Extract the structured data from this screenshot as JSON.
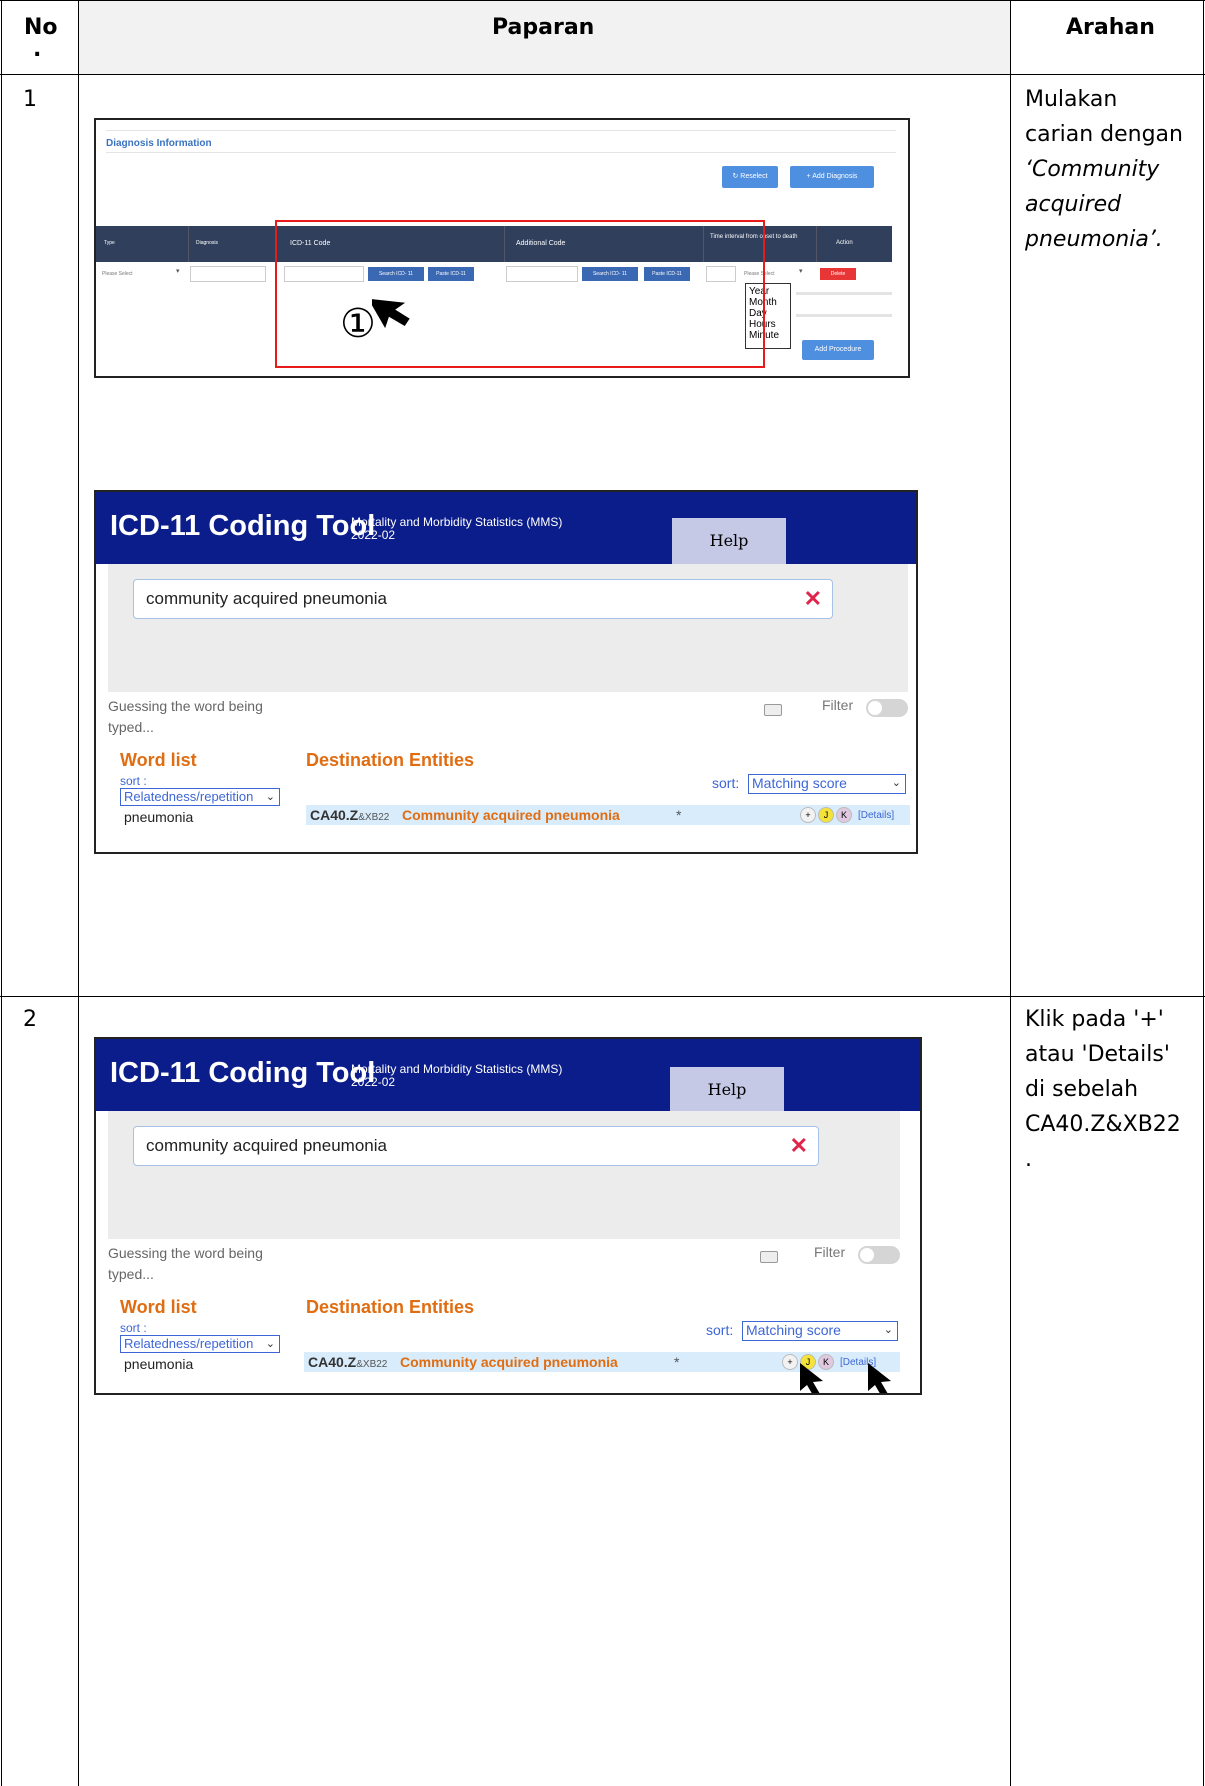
{
  "table": {
    "headers": {
      "no": "No",
      "no_dot": ".",
      "paparan": "Paparan",
      "arahan": "Arahan"
    },
    "rows": [
      {
        "no": "1",
        "arahan_lines": [
          "Mulakan",
          "carian dengan",
          "‘Community",
          "acquired",
          "pneumonia’."
        ]
      },
      {
        "no": "2",
        "arahan_lines": [
          "Klik pada '+'",
          "atau 'Details'",
          "di sebelah",
          "CA40.Z&XB22",
          "."
        ]
      }
    ]
  },
  "diagnosis_form": {
    "title": "Diagnosis Information",
    "reselect": "↻ Reselect",
    "add_diagnosis": "+ Add Diagnosis",
    "columns": [
      "Type",
      "Diagnosis",
      "ICD-11 Code",
      "Additional Code",
      "Time interval from onset to death",
      "Action"
    ],
    "type_placeholder": "Please Select",
    "search_btn": "Search ICD- 11",
    "paste_btn": "Paste ICD-11",
    "search_btn2": "Search ICD- 11",
    "paste_btn2": "Paste ICD-11",
    "time_select": "Please Select",
    "delete_btn": "Delete",
    "time_options": [
      "Year",
      "Month",
      "Day",
      "Hours",
      "Minute"
    ],
    "procedure_btn": "Add Procedure",
    "step_marker": "①"
  },
  "icd_tool": {
    "brand": "ICD-11 Coding Tool",
    "mms_line1": "Mortality and Morbidity Statistics (MMS)",
    "mms_line2": "2022-02",
    "help": "Help",
    "search_value": "community acquired pneumonia",
    "guess": "Guessing the word being typed...",
    "filter": "Filter",
    "word_list": "Word list",
    "sort_label": "sort :",
    "sort_word_value": "Relatedness/repetition",
    "word_item": "pneumonia",
    "destination": "Destination Entities",
    "sort_label2": "sort:",
    "sort_dest_value": "Matching score",
    "code": "CA40.Z",
    "code_ext": "&XB22",
    "entity": "Community acquired pneumonia",
    "star": "*",
    "plus": "+",
    "j": "J",
    "k": "K",
    "details": "[Details]"
  }
}
